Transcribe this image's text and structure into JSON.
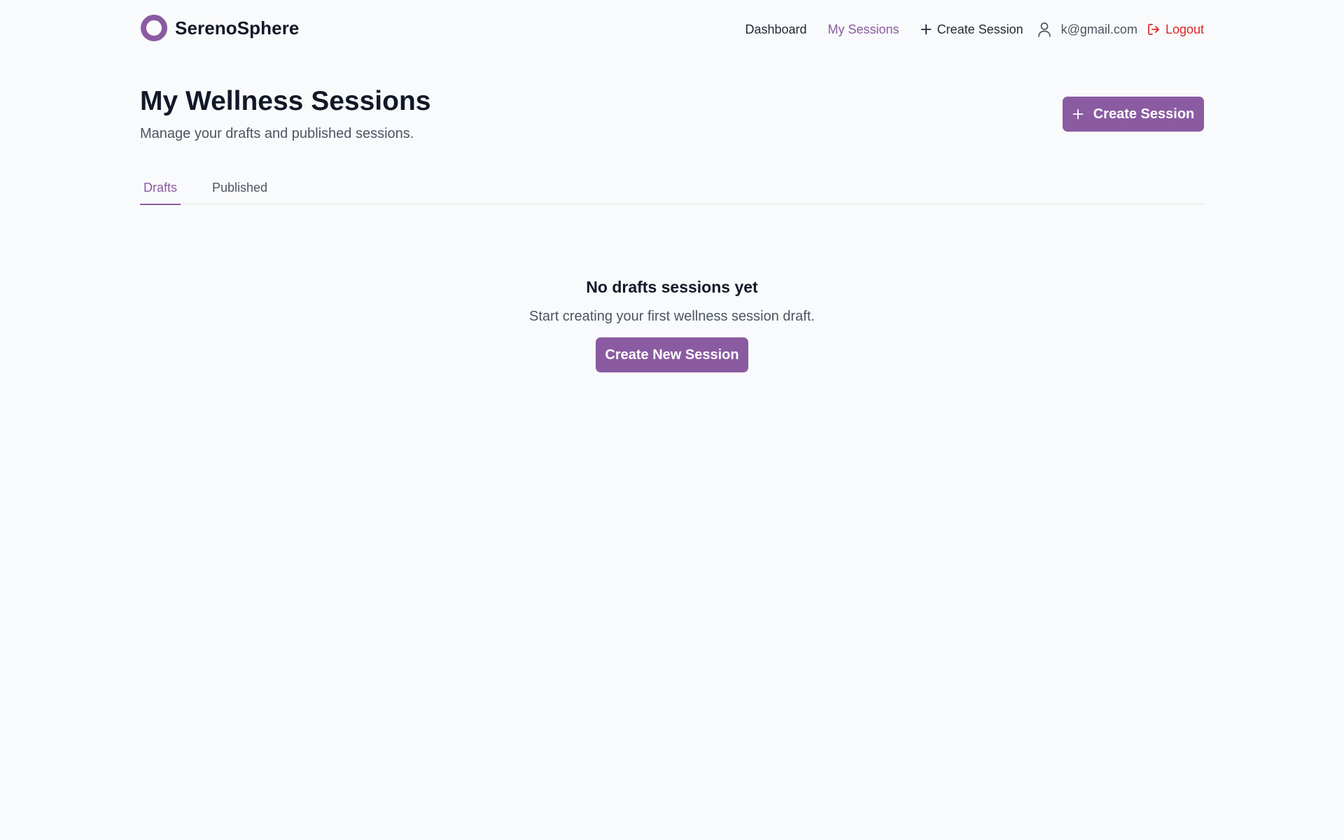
{
  "brand": {
    "name": "SerenoSphere",
    "color": "#8b5ba1"
  },
  "nav": {
    "dashboard": "Dashboard",
    "my_sessions": "My Sessions",
    "create_session": "Create Session",
    "user_email": "k@gmail.com",
    "logout": "Logout"
  },
  "page": {
    "title": "My Wellness Sessions",
    "subtitle": "Manage your drafts and published sessions.",
    "create_button": "Create Session"
  },
  "tabs": [
    {
      "label": "Drafts",
      "active": true
    },
    {
      "label": "Published",
      "active": false
    }
  ],
  "empty_state": {
    "title": "No drafts sessions yet",
    "text": "Start creating your first wellness session draft.",
    "button": "Create New Session"
  },
  "icons": {
    "logo": "ring-logo-icon",
    "create": "plus-icon",
    "user": "user-icon",
    "logout": "logout-icon"
  },
  "colors": {
    "accent": "#8b5ba1",
    "logout": "#dc2626",
    "background": "#f9fafb"
  }
}
